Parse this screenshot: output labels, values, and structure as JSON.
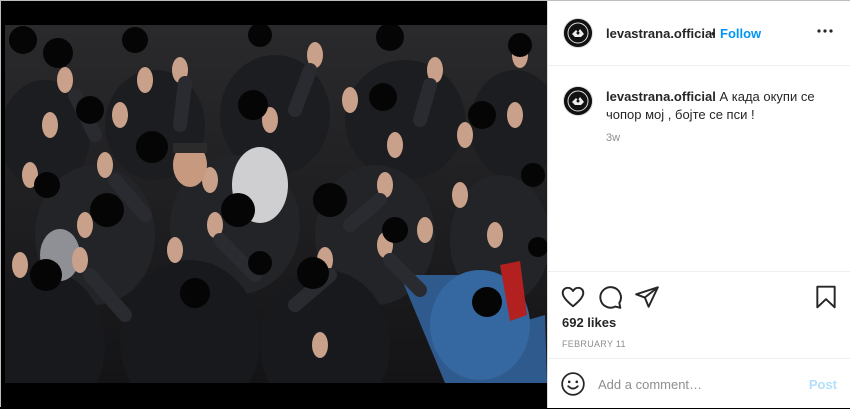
{
  "post": {
    "username": "levastrana.official",
    "separator": "•",
    "follow_label": "Follow",
    "more_icon": "more-horizontal-icon"
  },
  "caption": {
    "username": "levastrana.official",
    "text": "А када окупи се чопор мој , бојте се пси !",
    "time_ago": "3w"
  },
  "actions": {
    "like_icon": "heart-icon",
    "comment_icon": "comment-icon",
    "share_icon": "share-icon",
    "save_icon": "bookmark-icon",
    "likes": "692 likes",
    "date": "FEBRUARY 11"
  },
  "comment": {
    "emoji_icon": "smiley-icon",
    "placeholder": "Add a comment…",
    "post_label": "Post"
  },
  "colors": {
    "link": "#0095f6",
    "post_disabled": "#b2dffc",
    "text": "#262626",
    "muted": "#8e8e8e"
  }
}
